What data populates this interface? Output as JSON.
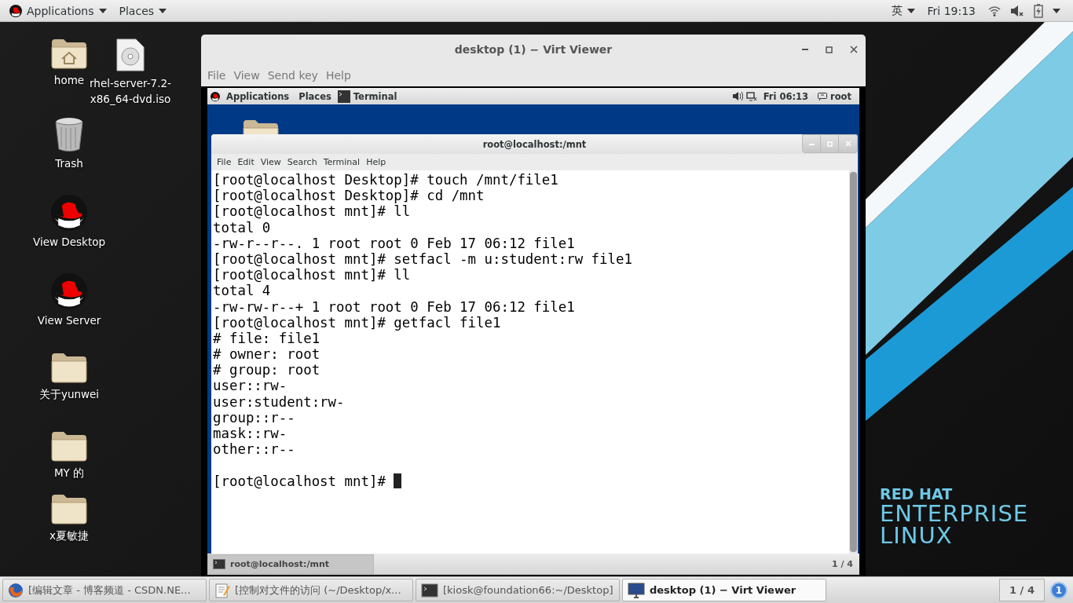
{
  "top_bar": {
    "menus": [
      "Applications",
      "Places"
    ],
    "input_method": "英",
    "clock": "Fri 19:13"
  },
  "desktop_icons": [
    {
      "label": "home",
      "kind": "home"
    },
    {
      "label": "rhel-server-7.2-x86_64-dvd.iso",
      "kind": "disc"
    },
    {
      "label": "Trash",
      "kind": "trash"
    },
    {
      "label": "View Desktop",
      "kind": "redhat"
    },
    {
      "label": "View Server",
      "kind": "redhat"
    },
    {
      "label": "关于yunwei",
      "kind": "folder"
    },
    {
      "label": "MY 的",
      "kind": "folder"
    },
    {
      "label": "x夏敏捷",
      "kind": "folder"
    }
  ],
  "wallpaper_logo": {
    "line_1": "RED HAT",
    "line_2": "ENTERPRISE",
    "line_3": "LINUX"
  },
  "viewer_window": {
    "title": "desktop (1) − Virt Viewer",
    "menus": [
      "File",
      "View",
      "Send key",
      "Help"
    ],
    "guest": {
      "top_bar": {
        "menus": [
          "Applications",
          "Places"
        ],
        "task": "Terminal",
        "clock": "Fri 06:13",
        "user": "root"
      },
      "terminal": {
        "title": "root@localhost:/mnt",
        "menus": [
          "File",
          "Edit",
          "View",
          "Search",
          "Terminal",
          "Help"
        ],
        "lines": [
          "[root@localhost Desktop]# touch /mnt/file1",
          "[root@localhost Desktop]# cd /mnt",
          "[root@localhost mnt]# ll",
          "total 0",
          "-rw-r--r--. 1 root root 0 Feb 17 06:12 file1",
          "[root@localhost mnt]# setfacl -m u:student:rw file1",
          "[root@localhost mnt]# ll",
          "total 4",
          "-rw-rw-r--+ 1 root root 0 Feb 17 06:12 file1",
          "[root@localhost mnt]# getfacl file1",
          "# file: file1",
          "# owner: root",
          "# group: root",
          "user::rw-",
          "user:student:rw-",
          "group::r--",
          "mask::rw-",
          "other::r--"
        ],
        "prompt": "[root@localhost mnt]# "
      },
      "taskbar": {
        "items": [
          {
            "label": "root@localhost:/mnt",
            "selected": true
          }
        ],
        "workspace": "1 / 4"
      }
    }
  },
  "taskbar": {
    "items": [
      {
        "label": "[编辑文章 - 博客频道 - CSDN.NE...",
        "kind": "browser",
        "selected": false
      },
      {
        "label": "[控制对文件的访问 (~/Desktop/x...",
        "kind": "editor",
        "selected": false
      },
      {
        "label": "[kiosk@foundation66:~/Desktop]",
        "kind": "terminal",
        "selected": false
      },
      {
        "label": "desktop (1) − Virt Viewer",
        "kind": "viewer",
        "selected": true
      }
    ],
    "workspace": "1 / 4",
    "notifications": "1"
  }
}
